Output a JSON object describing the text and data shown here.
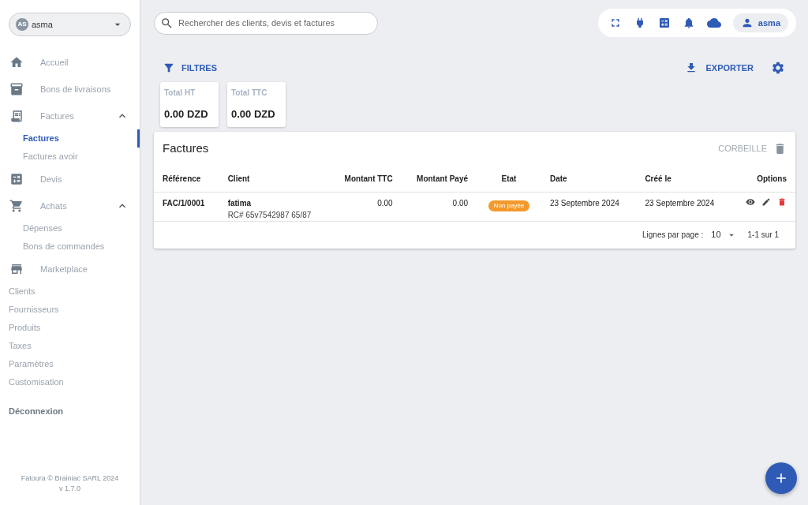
{
  "sidebar": {
    "account": {
      "initials": "AS",
      "name": "asma"
    },
    "items": [
      {
        "kind": "main",
        "label": "Accueil"
      },
      {
        "kind": "main",
        "label": "Bons de livraisons"
      },
      {
        "kind": "group",
        "label": "Factures",
        "expanded": true,
        "children": [
          {
            "label": "Factures",
            "selected": true
          },
          {
            "label": "Factures avoir",
            "selected": false
          }
        ]
      },
      {
        "kind": "main",
        "label": "Devis"
      },
      {
        "kind": "group",
        "label": "Achats",
        "expanded": true,
        "children": [
          {
            "label": "Dépenses",
            "selected": false
          },
          {
            "label": "Bons de commandes",
            "selected": false
          }
        ]
      },
      {
        "kind": "main",
        "label": "Marketplace"
      },
      {
        "kind": "plain",
        "label": "Clients"
      },
      {
        "kind": "plain",
        "label": "Fournisseurs"
      },
      {
        "kind": "plain",
        "label": "Produits"
      },
      {
        "kind": "plain",
        "label": "Taxes"
      },
      {
        "kind": "plain",
        "label": "Paramètres"
      },
      {
        "kind": "plain",
        "label": "Customisation"
      },
      {
        "kind": "logout",
        "label": "Déconnexion"
      }
    ],
    "footer": [
      "Fatoura © Brainiac SARL 2024",
      "v 1.7.0"
    ]
  },
  "search": {
    "placeholder": "Rechercher des clients, devis et factures"
  },
  "user": {
    "name": "asma"
  },
  "toolbar": {
    "filters": "FILTRES",
    "export": "EXPORTER"
  },
  "totals": [
    {
      "label": "Total HT",
      "value": "0.00 DZD"
    },
    {
      "label": "Total TTC",
      "value": "0.00 DZD"
    }
  ],
  "table": {
    "title": "Factures",
    "trash": "CORBEILLE",
    "columns": [
      "Référence",
      "Client",
      "Montant TTC",
      "Montant Payé",
      "Etat",
      "Date",
      "Créé le",
      "Options"
    ],
    "rows": [
      {
        "reference": "FAC/1/0001",
        "client": "fatima",
        "client_detail": "RC# 65v7542987 65/87",
        "amount": "0.00",
        "paid": "0.00",
        "status": {
          "label": "Non payée",
          "color": "#f39a2d"
        },
        "date": "23 Septembre 2024",
        "created": "23 Septembre 2024"
      }
    ],
    "pagination": {
      "label": "Lignes par page :",
      "per_page": "10",
      "range": "1-1 sur 1"
    }
  }
}
